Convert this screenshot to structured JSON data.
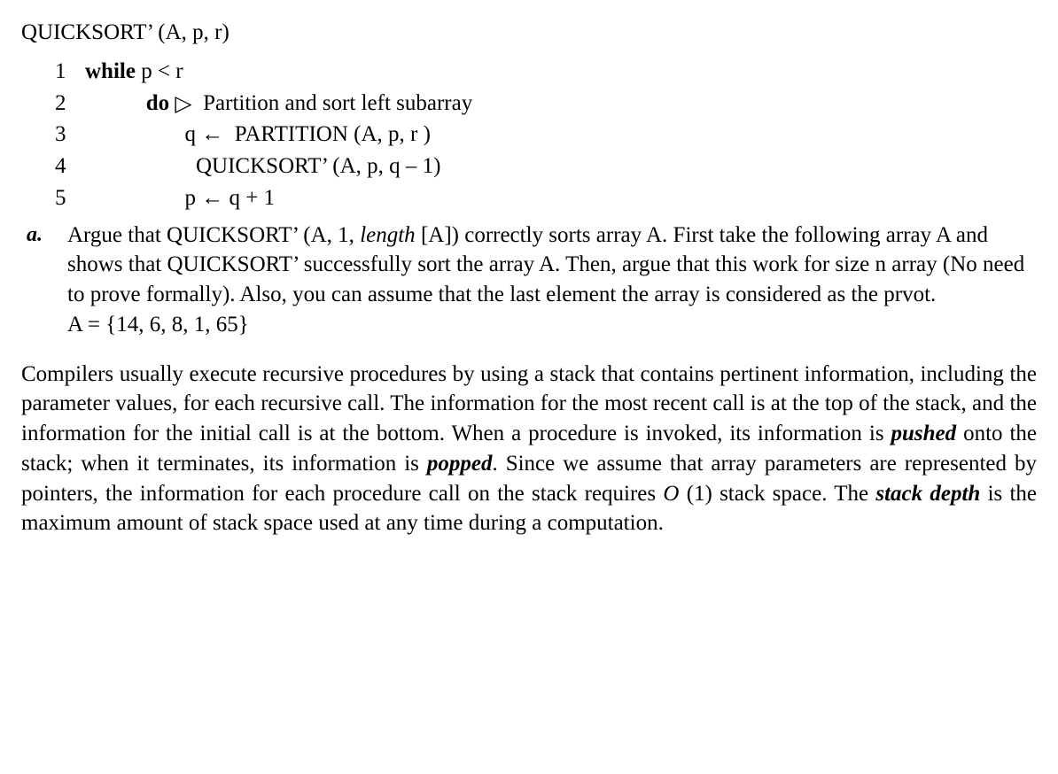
{
  "algo": {
    "header": "QUICKSORT’ (A, p, r)",
    "lines": {
      "l1": {
        "num": "1",
        "kw": "while",
        "cond": " p < r"
      },
      "l2": {
        "num": "2",
        "pad": "           ",
        "kw": "do",
        "tri": " ▷ ",
        "comment": " Partition and sort left subarray"
      },
      "l3": {
        "num": "3",
        "pad": "                  ",
        "text": "q ←  PARTITION (A, p, r )"
      },
      "l4": {
        "num": "4",
        "pad": "                    ",
        "text": "QUICKSORT’ (A, p, q – 1)"
      },
      "l5": {
        "num": "5",
        "pad": "                  ",
        "text": "p ← q + 1"
      }
    }
  },
  "question": {
    "label": "a.",
    "seg1": "Argue that QUICKSORT’ (A, 1, ",
    "italic1": "length",
    "seg2": " [A]) correctly sorts array A. First take the following array A and shows that QUICKSORT’ successfully sort the array A. Then, argue that this work for size n array (No need to prove formally). Also, you can assume that the last element the array is considered as the prvot.",
    "arr": "A = {14, 6, 8, 1, 65}"
  },
  "paragraph": {
    "p1": "Compilers usually execute recursive procedures by using a stack that contains pertinent information, including the parameter values, for each recursive call. The information for the most recent call is at the top of the stack, and the information for the initial call is at the bottom. When a procedure is invoked, its information is ",
    "pushed": "pushed",
    "p2": " onto the stack; when it terminates, its information is ",
    "popped": "popped",
    "p3": ". Since we assume that array parameters are represented by pointers, the information for each procedure call on the stack requires ",
    "bigO": "O",
    "p4": " (1) stack space. The ",
    "stackdepth": "stack depth",
    "p5": " is the maximum amount of stack space used at any time during a computation."
  }
}
